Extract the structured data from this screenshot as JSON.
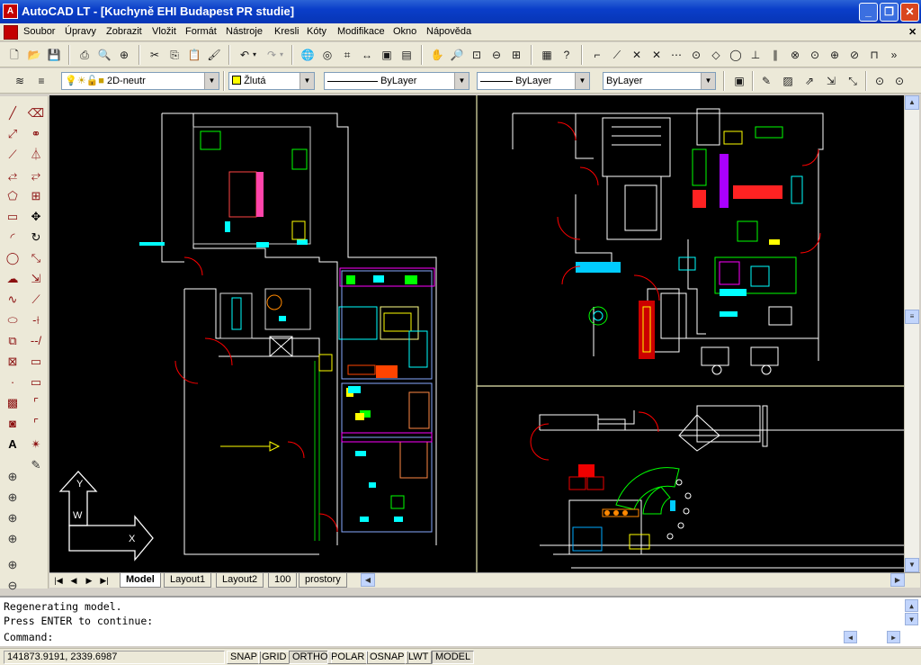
{
  "window": {
    "title": "AutoCAD LT - [Kuchyně EHI Budapest PR studie]",
    "minimize": "_",
    "restore": "❐",
    "close": "✕"
  },
  "menu": [
    "Soubor",
    "Úpravy",
    "Zobrazit",
    "Vložit",
    "Formát",
    "Nástroje",
    "Kresli",
    "Kóty",
    "Modifikace",
    "Okno",
    "Nápověda"
  ],
  "layer_toolbar": {
    "layer_value": "2D-neutr",
    "color_value": "Žlutá",
    "linetype_value": "ByLayer",
    "lineweight_value": "ByLayer",
    "plotstyle_value": "ByLayer"
  },
  "tabs": [
    "Model",
    "Layout1",
    "Layout2",
    "100",
    "prostory"
  ],
  "active_tab": "Model",
  "command": {
    "line1": "Regenerating model.",
    "line2": "Press ENTER to continue:",
    "line3": "Command:"
  },
  "status": {
    "coords": "141873.9191, 2339.6987",
    "buttons": [
      "SNAP",
      "GRID",
      "ORTHO",
      "POLAR",
      "OSNAP",
      "LWT",
      "MODEL"
    ],
    "on": [
      "ORTHO",
      "MODEL"
    ]
  },
  "ucs": {
    "y": "Y",
    "w1": "W",
    "x": "X"
  },
  "colors": {
    "titlebar": "#0a3ec9",
    "canvas": "#000000",
    "viewport_border": "#d8d8a0"
  }
}
